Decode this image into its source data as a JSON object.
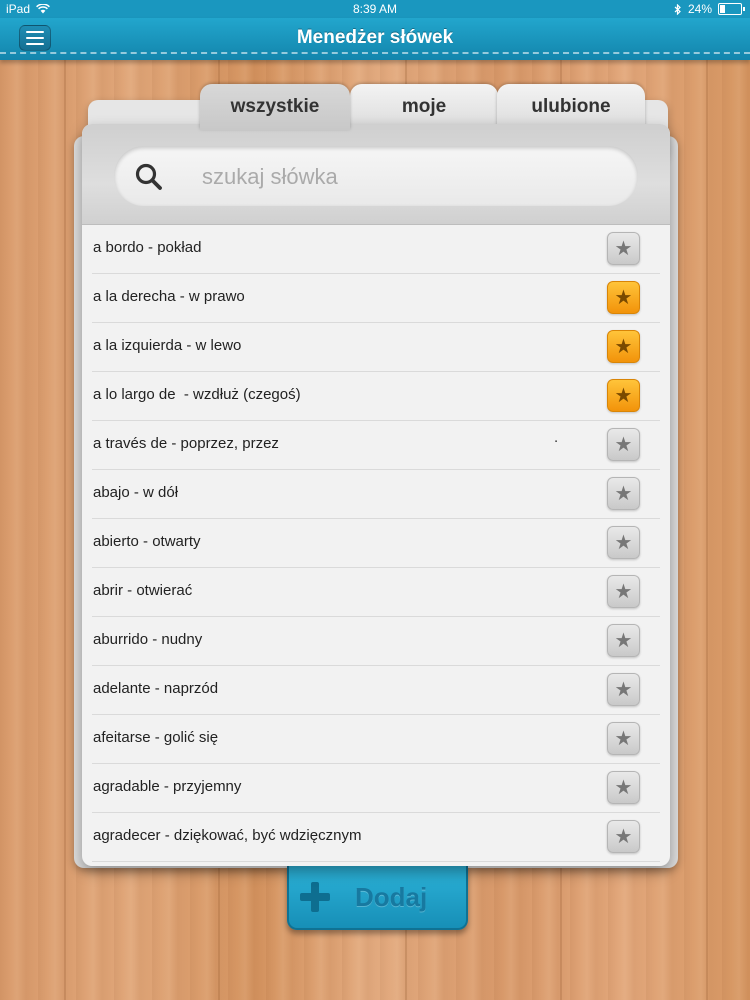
{
  "status_bar": {
    "device": "iPad",
    "time": "8:39 AM",
    "battery": "24%",
    "battery_level": 0.24
  },
  "header": {
    "title": "Menedżer słówek",
    "menu_icon": "hamburger-menu-icon"
  },
  "tabs": [
    {
      "label": "wszystkie",
      "active": true
    },
    {
      "label": "moje",
      "active": false
    },
    {
      "label": "ulubione",
      "active": false
    }
  ],
  "search": {
    "placeholder": "szukaj słówka",
    "value": "",
    "icon": "search-icon"
  },
  "words": [
    {
      "text": "a bordo - pokład",
      "favorite": false
    },
    {
      "text": "a la derecha - w prawo",
      "favorite": true
    },
    {
      "text": "a la izquierda - w lewo",
      "favorite": true
    },
    {
      "text": "a lo largo de  - wzdłuż (czegoś)",
      "favorite": true
    },
    {
      "text": "a través de - poprzez, przez",
      "favorite": false,
      "extra": "."
    },
    {
      "text": "abajo - w dół",
      "favorite": false
    },
    {
      "text": "abierto - otwarty",
      "favorite": false
    },
    {
      "text": "abrir - otwierać",
      "favorite": false
    },
    {
      "text": "aburrido - nudny",
      "favorite": false
    },
    {
      "text": "adelante - naprzód",
      "favorite": false
    },
    {
      "text": "afeitarse - golić się",
      "favorite": false
    },
    {
      "text": "agradable - przyjemny",
      "favorite": false
    },
    {
      "text": "agradecer - dziękować, być wdzięcznym",
      "favorite": false
    }
  ],
  "add_button": {
    "label": "Dodaj",
    "icon": "plus-icon"
  },
  "colors": {
    "accent": "#1a97bf",
    "favorite": "#f5a623"
  }
}
